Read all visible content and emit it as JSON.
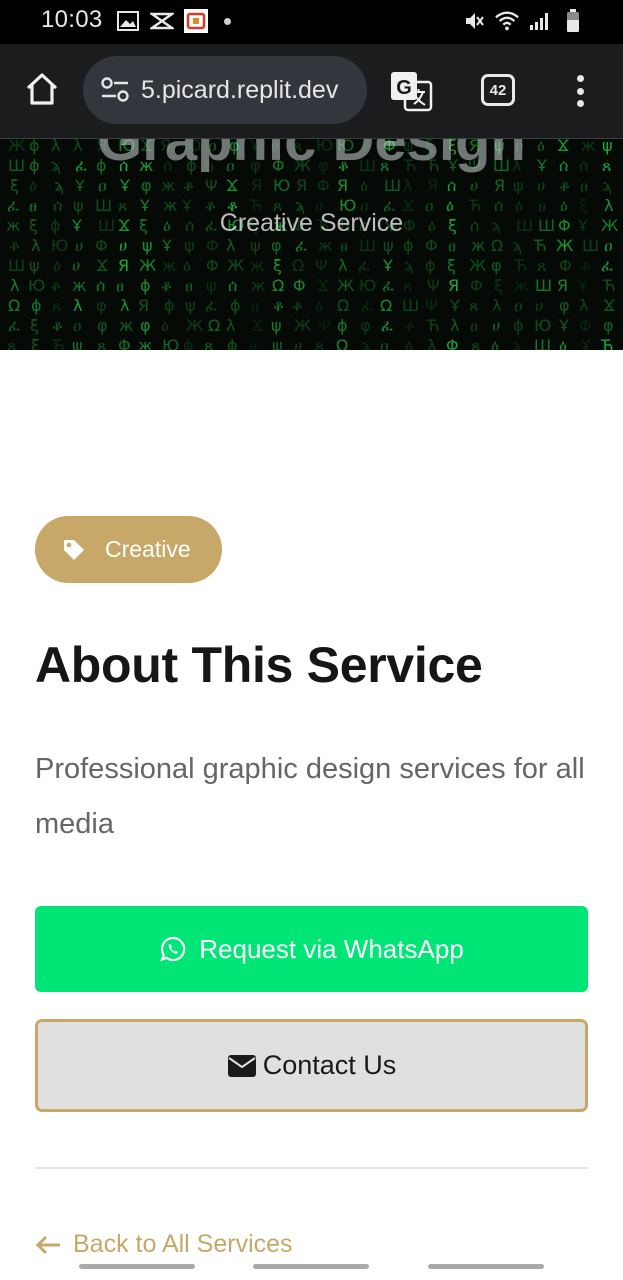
{
  "status_bar": {
    "time": "10:03",
    "left_icons": [
      "gallery-icon",
      "capcut-icon",
      "notification-app-icon"
    ],
    "right_icons": [
      "mute-icon",
      "wifi-icon",
      "signal-icon",
      "battery-icon"
    ]
  },
  "browser": {
    "url": "5.picard.replit.dev",
    "tab_count": "42",
    "icons": [
      "home-icon",
      "site-settings-icon",
      "translate-icon",
      "tabs-icon",
      "more-icon"
    ]
  },
  "hero": {
    "title": "Graphic Design",
    "subtitle": "Creative Service"
  },
  "service": {
    "tag": "Creative",
    "heading": "About This Service",
    "description": "Professional graphic design services for all media"
  },
  "actions": {
    "whatsapp_label": "Request via WhatsApp",
    "contact_label": "Contact Us",
    "back_label": "Back to All Services"
  },
  "colors": {
    "accent_gold": "#c8a868",
    "whatsapp_green": "#00e676",
    "hero_background": "#050a07",
    "matrix_green": "#22c840"
  }
}
